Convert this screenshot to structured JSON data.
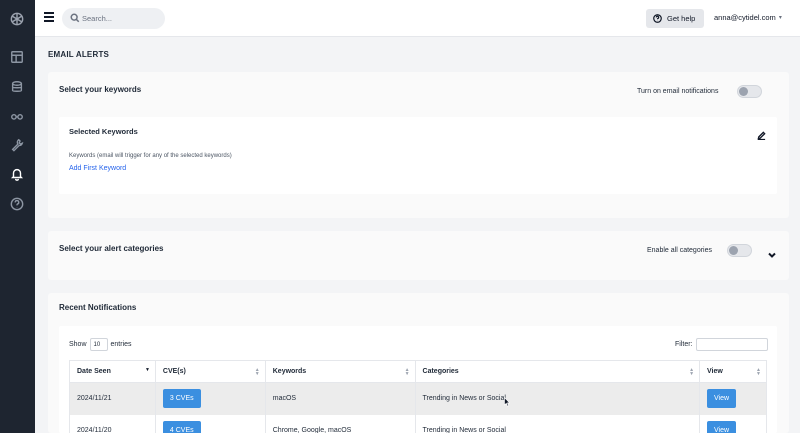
{
  "header": {
    "search_placeholder": "Search...",
    "get_help": "Get help",
    "user_email": "anna@cytidel.com"
  },
  "page": {
    "title": "EMAIL ALERTS"
  },
  "keywords_section": {
    "title": "Select your keywords",
    "toggle_label": "Turn on email notifications",
    "selected_title": "Selected Keywords",
    "hint": "Keywords (email will trigger for any of the selected keywords)",
    "add_link": "Add First Keyword"
  },
  "categories_section": {
    "title": "Select your alert categories",
    "toggle_label": "Enable all categories"
  },
  "notifications": {
    "title": "Recent Notifications",
    "show_label": "Show",
    "entries_value": "10",
    "entries_label": "entries",
    "filter_label": "Filter:",
    "columns": [
      "Date Seen",
      "CVE(s)",
      "Keywords",
      "Categories",
      "View"
    ],
    "rows": [
      {
        "date": "2024/11/21",
        "cves": "3 CVEs",
        "keywords": "macOS",
        "categories": "Trending in News or Social",
        "view": "View"
      },
      {
        "date": "2024/11/20",
        "cves": "4 CVEs",
        "keywords": "Chrome, Google, macOS",
        "categories": "Trending in News or Social",
        "view": "View"
      }
    ]
  },
  "icons": {
    "sidebar": [
      "logo-icon",
      "dashboard-icon",
      "database-icon",
      "glasses-icon",
      "wrench-icon",
      "bell-icon",
      "help-icon"
    ]
  },
  "colors": {
    "sidebar_bg": "#1e2530",
    "primary_button": "#3b8fe0",
    "link": "#2563eb"
  }
}
